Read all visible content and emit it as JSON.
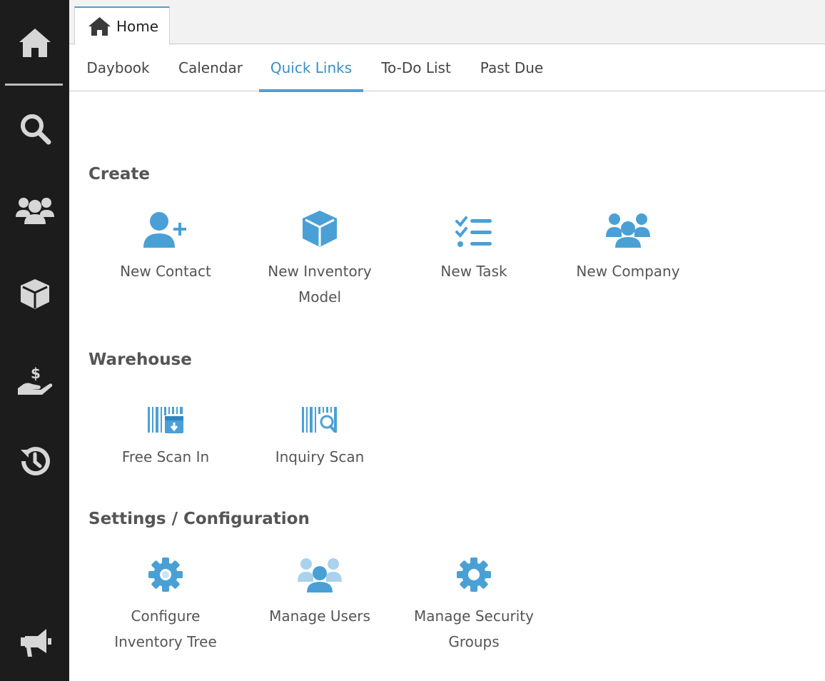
{
  "colors": {
    "accent": "#4aa0d5",
    "sidebar_bg": "#1c1c1c",
    "sidebar_icon": "#d6d6d6"
  },
  "sidebar": {
    "items": [
      {
        "name": "home-icon"
      },
      {
        "name": "search-icon"
      },
      {
        "name": "users-icon"
      },
      {
        "name": "box-icon"
      },
      {
        "name": "hand-dollar-icon"
      },
      {
        "name": "history-icon"
      },
      {
        "name": "megaphone-icon"
      }
    ]
  },
  "window_tabs": [
    {
      "label": "Home",
      "icon": "home-icon",
      "active": true
    }
  ],
  "subnav": {
    "tabs": [
      {
        "label": "Daybook",
        "active": false
      },
      {
        "label": "Calendar",
        "active": false
      },
      {
        "label": "Quick Links",
        "active": true
      },
      {
        "label": "To-Do List",
        "active": false
      },
      {
        "label": "Past Due",
        "active": false
      }
    ]
  },
  "sections": [
    {
      "title": "Create",
      "links": [
        {
          "label": "New Contact",
          "icon": "user-plus-icon"
        },
        {
          "label": "New Inventory Model",
          "icon": "cube-icon"
        },
        {
          "label": "New Task",
          "icon": "task-list-icon"
        },
        {
          "label": "New Company",
          "icon": "company-icon"
        }
      ]
    },
    {
      "title": "Warehouse",
      "links": [
        {
          "label": "Free Scan In",
          "icon": "barcode-scan-in-icon"
        },
        {
          "label": "Inquiry Scan",
          "icon": "barcode-search-icon"
        }
      ]
    },
    {
      "title": "Settings / Configuration",
      "links": [
        {
          "label": "Configure Inventory Tree",
          "icon": "gear-icon"
        },
        {
          "label": "Manage Users",
          "icon": "manage-users-icon"
        },
        {
          "label": "Manage Security Groups",
          "icon": "gear-icon"
        }
      ]
    }
  ]
}
